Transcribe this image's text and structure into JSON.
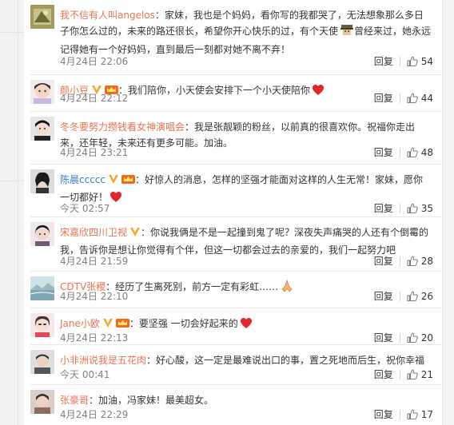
{
  "actions": {
    "reply_label": "回复"
  },
  "comments": [
    {
      "user": "我不信有人叫angelos",
      "text": "：家妹，我也是个妈妈，看你写的我都哭了，无法想象那么多日子你怎么过的，未来的路还很长，希望你开心快乐的过，有个天使",
      "text2": "曾经来过，她永远记得她有一个好妈妈，直到最后一刻都对她不离不弃！",
      "time": "4月24日 22:06",
      "likes": "54"
    },
    {
      "user": "颜小豆",
      "text": "：我们陪你，小天使会安排下一个小天使陪你",
      "time": "4月24日 22:12",
      "likes": "44"
    },
    {
      "user": "冬冬要努力攒钱看女神演唱会",
      "text": "：我是张靓颖的粉丝，以前真的很喜欢你。祝福你走出来，还年轻，未来还有更多可能。加油。",
      "time": "4月24日 23:21",
      "likes": "48"
    },
    {
      "user": "陈晨ccccc",
      "text": "：好惊人的消息，怎样的坚强才能面对这样的人生无常！家妹，愿你一切都好！",
      "time": "今天 02:57",
      "likes": "35"
    },
    {
      "user": "宋嘉欣四川卫视",
      "text": "：你说我俩是不是一起撞到鬼了呢？深夜失声痛哭的人还有个倒霉的我，告诉你是想让你觉得有个伴，但这一切都会过去的亲爱的，我们一起努力吧",
      "time": "4月24日 21:59",
      "likes": "28"
    },
    {
      "user": "CDTV张稷",
      "text": "：经历了生离死别，前方一定有彩虹……",
      "time": "4月24日 22:10",
      "likes": "26"
    },
    {
      "user": "Jane小欧",
      "text": "：要坚强 一切会好起来的",
      "time": "4月24日 22:13",
      "likes": "20"
    },
    {
      "user": "小非洲说我是五花肉",
      "text": "：好心酸，这一定是最难说出口的事，置之死地而后生，祝你幸福",
      "time": "今天 00:41",
      "likes": "21"
    },
    {
      "user": "张豪哥",
      "text": "：加油，冯家妹！最美超女。",
      "time": "4月24日 22:29",
      "likes": "17"
    }
  ]
}
